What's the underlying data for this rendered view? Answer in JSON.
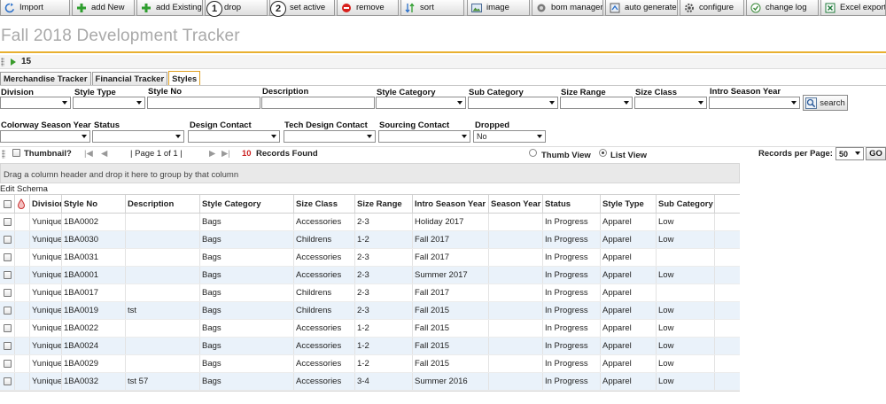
{
  "toolbar": {
    "buttons": [
      {
        "label": "Import",
        "icon": "refresh-icon"
      },
      {
        "label": "add New",
        "icon": "plus-icon"
      },
      {
        "label": "add Existing",
        "icon": "plus-icon"
      },
      {
        "label": "drop",
        "icon": "none"
      },
      {
        "label": "set active",
        "icon": "none"
      },
      {
        "label": "remove",
        "icon": "minus-circle-icon"
      },
      {
        "label": "sort",
        "icon": "sort-icon"
      },
      {
        "label": "image",
        "icon": "image-icon"
      },
      {
        "label": "bom manager",
        "icon": "bom-icon"
      },
      {
        "label": "auto generate",
        "icon": "auto-generate-icon"
      },
      {
        "label": "configure",
        "icon": "configure-icon"
      },
      {
        "label": "change log",
        "icon": "change-log-icon"
      },
      {
        "label": "Excel export",
        "icon": "excel-icon"
      }
    ],
    "callouts": [
      "1",
      "2"
    ]
  },
  "page": {
    "title": "Fall 2018 Development Tracker",
    "count": "15"
  },
  "tabs": [
    {
      "label": "Merchandise Tracker",
      "active": false
    },
    {
      "label": "Financial Tracker",
      "active": false
    },
    {
      "label": "Styles",
      "active": true
    }
  ],
  "filters": {
    "division": {
      "label": "Division",
      "value": ""
    },
    "style_type": {
      "label": "Style Type",
      "value": ""
    },
    "style_no": {
      "label": "Style No",
      "value": ""
    },
    "description": {
      "label": "Description",
      "value": ""
    },
    "style_category": {
      "label": "Style Category",
      "value": ""
    },
    "sub_category": {
      "label": "Sub Category",
      "value": ""
    },
    "size_range": {
      "label": "Size Range",
      "value": ""
    },
    "size_class": {
      "label": "Size Class",
      "value": ""
    },
    "intro_season_year": {
      "label": "Intro Season Year",
      "value": ""
    },
    "colorway_season_year": {
      "label": "Colorway Season Year",
      "value": ""
    },
    "status": {
      "label": "Status",
      "value": ""
    },
    "design_contact": {
      "label": "Design Contact",
      "value": ""
    },
    "tech_design_contact": {
      "label": "Tech Design Contact",
      "value": ""
    },
    "sourcing_contact": {
      "label": "Sourcing Contact",
      "value": ""
    },
    "dropped": {
      "label": "Dropped",
      "value": "No"
    },
    "search_label": "search"
  },
  "pager": {
    "thumbnail_label": "Thumbnail?",
    "page_text": "| Page 1 of 1 |",
    "records_count": "10",
    "records_found": "Records Found",
    "thumb_view": "Thumb View",
    "list_view": "List View",
    "records_per_page_label": "Records per Page:",
    "records_per_page": "50",
    "go_label": "GO"
  },
  "grid": {
    "group_hint": "Drag a column header and drop it here to group by that column",
    "edit_schema": "Edit Schema",
    "columns": [
      "Division",
      "Style No",
      "Description",
      "Style Category",
      "Size Class",
      "Size Range",
      "Intro Season Year",
      "Season Year",
      "Status",
      "Style Type",
      "Sub Category"
    ],
    "rows": [
      [
        "Yunique Apparel",
        "1BA0002",
        "",
        "Bags",
        "Accessories",
        "2-3",
        "Holiday 2017",
        "",
        "In Progress",
        "Apparel",
        "Low"
      ],
      [
        "Yunique Apparel",
        "1BA0030",
        "",
        "Bags",
        "Childrens",
        "1-2",
        "Fall 2017",
        "",
        "In Progress",
        "Apparel",
        "Low"
      ],
      [
        "Yunique Apparel",
        "1BA0031",
        "",
        "Bags",
        "Accessories",
        "2-3",
        "Fall 2017",
        "",
        "In Progress",
        "Apparel",
        ""
      ],
      [
        "Yunique Apparel",
        "1BA0001",
        "",
        "Bags",
        "Accessories",
        "2-3",
        "Summer 2017",
        "",
        "In Progress",
        "Apparel",
        "Low"
      ],
      [
        "Yunique Apparel",
        "1BA0017",
        "",
        "Bags",
        "Childrens",
        "2-3",
        "Fall 2017",
        "",
        "In Progress",
        "Apparel",
        ""
      ],
      [
        "Yunique Apparel",
        "1BA0019",
        "tst",
        "Bags",
        "Childrens",
        "2-3",
        "Fall 2015",
        "",
        "In Progress",
        "Apparel",
        "Low"
      ],
      [
        "Yunique Apparel",
        "1BA0022",
        "",
        "Bags",
        "Accessories",
        "1-2",
        "Fall 2015",
        "",
        "In Progress",
        "Apparel",
        "Low"
      ],
      [
        "Yunique Apparel",
        "1BA0024",
        "",
        "Bags",
        "Accessories",
        "1-2",
        "Fall 2015",
        "",
        "In Progress",
        "Apparel",
        "Low"
      ],
      [
        "Yunique Apparel",
        "1BA0029",
        "",
        "Bags",
        "Accessories",
        "1-2",
        "Fall 2015",
        "",
        "In Progress",
        "Apparel",
        "Low"
      ],
      [
        "Yunique Apparel",
        "1BA0032",
        "tst 57",
        "Bags",
        "Accessories",
        "3-4",
        "Summer 2016",
        "",
        "In Progress",
        "Apparel",
        "Low"
      ]
    ]
  },
  "colors": {
    "title_gray": "#a9a9a9",
    "accent_orange": "#e8b030",
    "records_red": "#cc2222",
    "row_alt": "#eaf2fa",
    "play_green": "#3a9c2c"
  }
}
